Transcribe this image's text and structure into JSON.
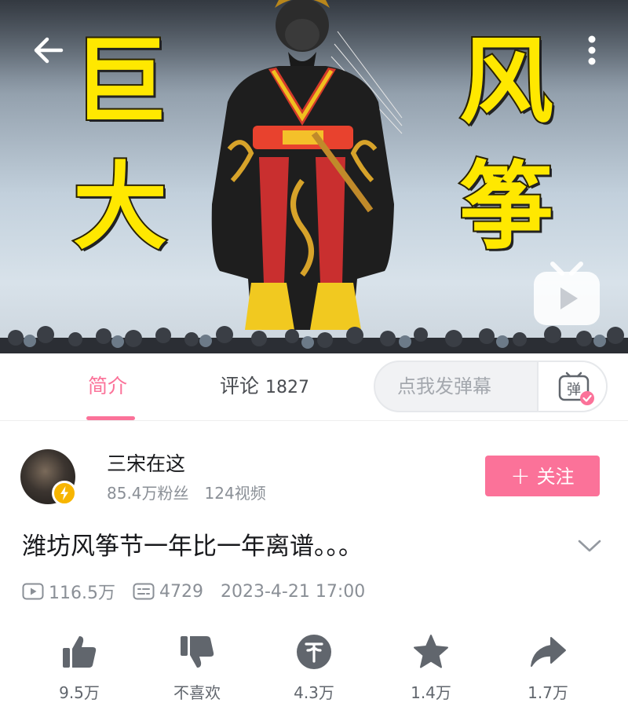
{
  "video": {
    "cover_chars": [
      "巨",
      "大",
      "风",
      "筝"
    ]
  },
  "tabs": {
    "intro_label": "简介",
    "comments_label": "评论",
    "comments_count": "1827"
  },
  "danmaku": {
    "placeholder": "点我发弹幕",
    "button_glyph": "弹"
  },
  "uploader": {
    "name": "三宋在这",
    "followers": "85.4万粉丝",
    "videos": "124视频",
    "follow_label": "关注"
  },
  "video_info": {
    "title": "潍坊风筝节一年比一年离谱。。。",
    "views": "116.5万",
    "danmaku_count": "4729",
    "publish_time": "2023-4-21 17:00"
  },
  "actions": {
    "like": "9.5万",
    "dislike": "不喜欢",
    "coin": "4.3万",
    "favorite": "1.4万",
    "share": "1.7万"
  },
  "colors": {
    "accent": "#fb7299",
    "icon_gray": "#61666d",
    "caption_yellow": "#ffe800"
  }
}
